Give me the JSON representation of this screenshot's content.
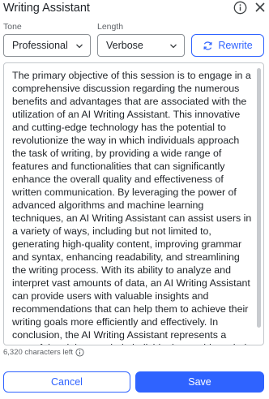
{
  "header": {
    "title": "Writing Assistant",
    "info_icon": "info-icon",
    "close_icon": "close-icon"
  },
  "controls": {
    "tone_label": "Tone",
    "tone_value": "Professional",
    "length_label": "Length",
    "length_value": "Verbose",
    "rewrite_label": "Rewrite",
    "rewrite_icon": "refresh-icon"
  },
  "editor": {
    "text": "The primary objective of this session is to engage in a comprehensive discussion regarding the numerous benefits and advantages that are associated with the utilization of an AI Writing Assistant. This innovative and cutting-edge technology has the potential to revolutionize the way in which individuals approach the task of writing, by providing a wide range of features and functionalities that can significantly enhance the overall quality and effectiveness of written communication. By leveraging the power of advanced algorithms and machine learning techniques, an AI Writing Assistant can assist users in a variety of ways, including but not limited to, generating high-quality content, improving grammar and syntax, enhancing readability, and streamlining the writing process. With its ability to analyze and interpret vast amounts of data, an AI Writing Assistant can provide users with valuable insights and recommendations that can help them to achieve their writing goals more efficiently and effectively. In conclusion, the AI Writing Assistant represents a powerful tool that can help individuals to achieve their writing objectives with greater"
  },
  "footer": {
    "counter_text": "6,320 characters left",
    "counter_icon": "info-icon",
    "cancel_label": "Cancel",
    "save_label": "Save"
  },
  "colors": {
    "accent": "#2f63ff",
    "text": "#1f2328",
    "muted": "#5f6368"
  }
}
